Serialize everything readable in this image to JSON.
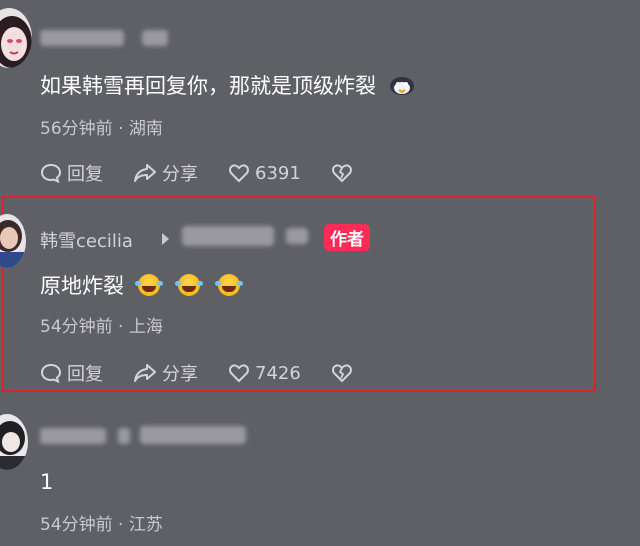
{
  "comments": [
    {
      "content": "如果韩雪再回复你，那就是顶级炸裂",
      "meta": "56分钟前 · 湖南",
      "reply_label": "回复",
      "share_label": "分享",
      "like_count": "6391"
    },
    {
      "username": "韩雪cecilia",
      "author_badge": "作者",
      "content": "原地炸裂",
      "meta": "54分钟前 · 上海",
      "reply_label": "回复",
      "share_label": "分享",
      "like_count": "7426"
    },
    {
      "content": "1",
      "meta": "54分钟前 · 江苏"
    }
  ],
  "colors": {
    "background": "#5f5f66",
    "author_badge": "#fe2c55",
    "highlight_border": "#d8252b"
  },
  "icons": [
    "comment-bubble-icon",
    "share-arrow-icon",
    "heart-icon",
    "broken-heart-icon",
    "laughing-emoji-icon",
    "penguin-emoji-icon",
    "triangle-arrow-icon"
  ]
}
